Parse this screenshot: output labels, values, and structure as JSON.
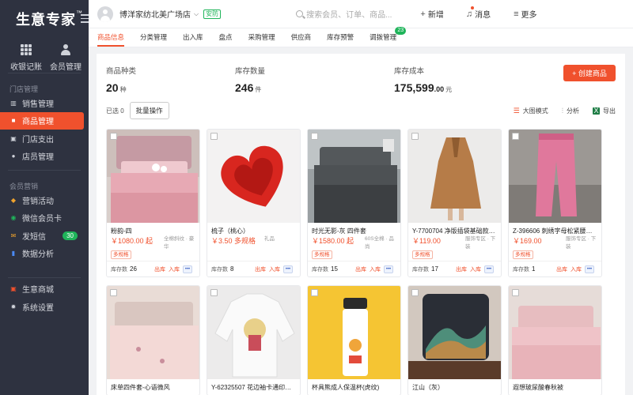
{
  "sidebar": {
    "brand": "生意专家",
    "brand_tm": "™",
    "tiles": [
      {
        "label": "收银记账",
        "icon": "grid-icon"
      },
      {
        "label": "会员管理",
        "icon": "user-icon"
      }
    ],
    "sections": [
      {
        "title": "门店管理",
        "items": [
          {
            "label": "销售管理",
            "icon": "chart-icon"
          },
          {
            "label": "商品管理",
            "icon": "box-icon",
            "active": true
          },
          {
            "label": "门店支出",
            "icon": "wallet-icon"
          },
          {
            "label": "店员管理",
            "icon": "person-icon"
          }
        ]
      },
      {
        "title": "会员营销",
        "items": [
          {
            "label": "营销活动",
            "icon": "megaphone-icon"
          },
          {
            "label": "微信会员卡",
            "icon": "wechat-icon"
          },
          {
            "label": "发短信",
            "icon": "mail-icon",
            "badge": "30"
          },
          {
            "label": "数据分析",
            "icon": "bar-chart-icon"
          }
        ]
      }
    ],
    "bottom": [
      {
        "label": "生意商城",
        "icon": "shop-icon"
      },
      {
        "label": "系统设置",
        "icon": "gear-icon"
      }
    ]
  },
  "header": {
    "store_name": "博洋家纺北美广场店",
    "store_tag": "安防",
    "search_placeholder": "搜索会员、订单、商品...",
    "add_label": "新增",
    "message_label": "消息",
    "more_label": "更多"
  },
  "tabs": [
    {
      "label": "商品信息",
      "active": true
    },
    {
      "label": "分类管理"
    },
    {
      "label": "出入库"
    },
    {
      "label": "盘点"
    },
    {
      "label": "采购管理"
    },
    {
      "label": "供应商"
    },
    {
      "label": "库存预警"
    },
    {
      "label": "调拨管理",
      "badge": "23"
    }
  ],
  "stats": {
    "kinds_label": "商品种类",
    "kinds_value": "20",
    "kinds_unit": "种",
    "qty_label": "库存数量",
    "qty_value": "246",
    "qty_unit": "件",
    "cost_label": "库存成本",
    "cost_value": "175,599",
    "cost_dec": ".00",
    "cost_unit": "元"
  },
  "create_button": "+ 创建商品",
  "toolbar": {
    "selected": "已选 0",
    "batch": "批量操作",
    "big_image": "大图模式",
    "analysis": "分析",
    "export": "导出"
  },
  "products": [
    {
      "name": "粉韵-四",
      "price": "￥1080.00 起",
      "tag": "多规格",
      "note": "全棉斜纹 · 豪华",
      "stock_label": "库存数",
      "stock": "26",
      "out": "出库",
      "in": "入库",
      "img": "pink-bed"
    },
    {
      "name": "梳子（桃心）",
      "price": "￥3.50 多规格",
      "tag": "",
      "note": "礼品",
      "stock_label": "库存数",
      "stock": "8",
      "out": "出库",
      "in": "入库",
      "img": "red-heart"
    },
    {
      "name": "时光无影-灰 四件套",
      "price": "￥1580.00 起",
      "tag": "多规格",
      "note": "60S全棉 · 品尚",
      "stock_label": "库存数",
      "stock": "15",
      "out": "出库",
      "in": "入库",
      "img": "gray-bed"
    },
    {
      "name": "Y-7700704 净版插袋基础款休闲…",
      "price": "￥119.00",
      "tag": "多规格",
      "note": "服饰专区 · 下装",
      "stock_label": "库存数",
      "stock": "17",
      "out": "出库",
      "in": "入库",
      "img": "camel-coat"
    },
    {
      "name": "Z-396606 刺绣字母松紧腰运动…",
      "price": "￥169.00",
      "tag": "多规格",
      "note": "服饰专区 · 下装",
      "stock_label": "库存数",
      "stock": "1",
      "out": "出库",
      "in": "入库",
      "img": "pink-pants"
    },
    {
      "name": "床单四件套-心语微风",
      "img": "light-bed"
    },
    {
      "name": "Y-62325507 花边袖卡通印花宽…",
      "img": "white-shirt"
    },
    {
      "name": "杯具熊成人保温杯(虎纹)",
      "img": "yellow-bottle"
    },
    {
      "name": "江山（灰）",
      "img": "pillow"
    },
    {
      "name": "遐想玻尿酸春秋被",
      "img": "pink-quilt"
    }
  ]
}
